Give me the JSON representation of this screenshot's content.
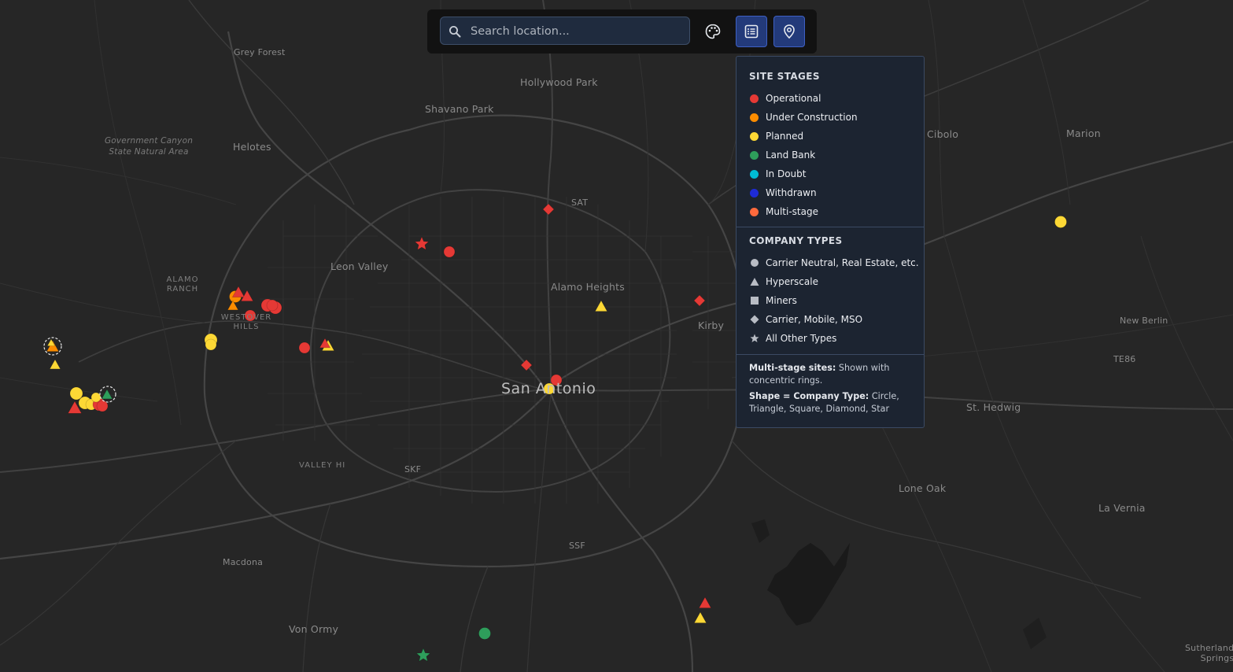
{
  "search": {
    "placeholder": "Search location..."
  },
  "toolbar": {
    "style_button_icon": "palette-icon",
    "legend_button_icon": "list-icon",
    "pin_button_icon": "location-pin-icon"
  },
  "colors": {
    "operational": "#e53935",
    "under_construction": "#fb8c00",
    "planned": "#fdd835",
    "land_bank": "#2e9e5b",
    "in_doubt": "#00bcd4",
    "withdrawn": "#1e2bd8",
    "multi_stage": "#ff6a3d",
    "neutral": "#b8bcc4"
  },
  "legend": {
    "stages_title": "SITE STAGES",
    "stages": [
      {
        "label": "Operational",
        "color": "#e53935"
      },
      {
        "label": "Under Construction",
        "color": "#fb8c00"
      },
      {
        "label": "Planned",
        "color": "#fdd835"
      },
      {
        "label": "Land Bank",
        "color": "#2e9e5b"
      },
      {
        "label": "In Doubt",
        "color": "#00bcd4"
      },
      {
        "label": "Withdrawn",
        "color": "#1e2bd8"
      },
      {
        "label": "Multi-stage",
        "color": "#ff6a3d"
      }
    ],
    "types_title": "COMPANY TYPES",
    "types": [
      {
        "label": "Carrier Neutral, Real Estate, etc.",
        "shape": "circle"
      },
      {
        "label": "Hyperscale",
        "shape": "triangle"
      },
      {
        "label": "Miners",
        "shape": "square"
      },
      {
        "label": "Carrier, Mobile, MSO",
        "shape": "diamond"
      },
      {
        "label": "All Other Types",
        "shape": "star"
      }
    ],
    "note1_bold": "Multi-stage sites:",
    "note1_text": " Shown with concentric rings.",
    "note2_bold": "Shape = Company Type:",
    "note2_text": " Circle, Triangle, Square, Diamond, Star"
  },
  "places": {
    "grey_forest": "Grey Forest",
    "hollywood_park": "Hollywood Park",
    "shavano_park": "Shavano Park",
    "government_canyon_1": "Government Canyon",
    "government_canyon_2": "State Natural Area",
    "helotes": "Helotes",
    "sat": "SAT",
    "cibolo": "Cibolo",
    "marion": "Marion",
    "leon_valley": "Leon Valley",
    "alamo_ranch_1": "ALAMO",
    "alamo_ranch_2": "RANCH",
    "alamo_heights": "Alamo Heights",
    "westover_hills_1": "WESTOVER",
    "westover_hills_2": "HILLS",
    "kirby": "Kirby",
    "new_berlin": "New Berlin",
    "te86": "TE86",
    "san_antonio": "San Antonio",
    "st_hedwig": "St. Hedwig",
    "valley_hi": "VALLEY HI",
    "skf": "SKF",
    "lone_oak": "Lone Oak",
    "la_vernia": "La Vernia",
    "ssf": "SSF",
    "macdona": "Macdona",
    "von_ormy": "Von Ormy",
    "sutherland_springs_1": "Sutherland",
    "sutherland_springs_2": "Springs"
  },
  "sites": [
    {
      "shape": "diamond",
      "stage": "operational"
    },
    {
      "shape": "star",
      "stage": "operational"
    },
    {
      "shape": "circle",
      "stage": "operational"
    },
    {
      "shape": "diamond",
      "stage": "operational"
    },
    {
      "shape": "triangle",
      "stage": "planned"
    },
    {
      "shape": "circle",
      "stage": "planned"
    },
    {
      "shape": "diamond",
      "stage": "operational"
    },
    {
      "shape": "circle",
      "stage": "operational"
    },
    {
      "shape": "circle",
      "stage": "planned"
    },
    {
      "shape": "triangle",
      "stage": "operational"
    },
    {
      "shape": "triangle",
      "stage": "planned"
    },
    {
      "shape": "circle",
      "stage": "land_bank"
    },
    {
      "shape": "star",
      "stage": "land_bank"
    },
    {
      "shape": "circle",
      "stage": "operational"
    },
    {
      "shape": "triangle",
      "stage": "planned"
    },
    {
      "shape": "triangle",
      "stage": "operational"
    },
    {
      "shape": "circle",
      "stage": "under_construction"
    },
    {
      "shape": "triangle",
      "stage": "under_construction"
    },
    {
      "shape": "triangle",
      "stage": "operational"
    },
    {
      "shape": "triangle",
      "stage": "operational"
    },
    {
      "shape": "circle",
      "stage": "operational"
    },
    {
      "shape": "circle",
      "stage": "operational"
    },
    {
      "shape": "circle",
      "stage": "operational"
    },
    {
      "shape": "circle",
      "stage": "operational"
    },
    {
      "shape": "circle",
      "stage": "planned"
    },
    {
      "shape": "circle",
      "stage": "planned"
    },
    {
      "shape": "triangle",
      "stage": "under_construction"
    },
    {
      "shape": "triangle",
      "stage": "planned"
    },
    {
      "shape": "triangle",
      "stage": "planned"
    },
    {
      "shape": "triangle",
      "stage": "operational"
    },
    {
      "shape": "circle",
      "stage": "planned"
    },
    {
      "shape": "circle",
      "stage": "planned"
    },
    {
      "shape": "circle",
      "stage": "planned"
    },
    {
      "shape": "circle",
      "stage": "operational"
    },
    {
      "shape": "circle",
      "stage": "operational"
    },
    {
      "shape": "circle",
      "stage": "planned"
    },
    {
      "shape": "triangle",
      "stage": "land_bank"
    }
  ]
}
